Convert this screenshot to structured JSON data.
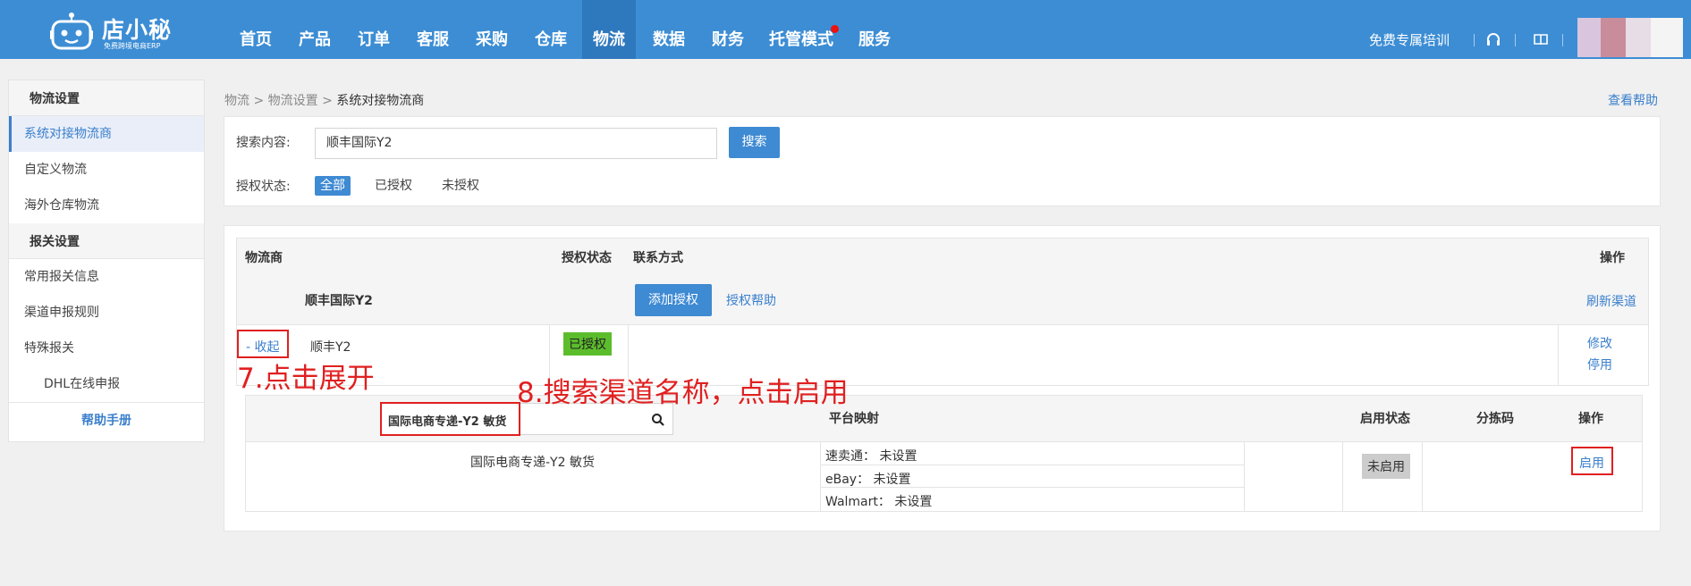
{
  "brand": {
    "title": "店小秘",
    "subtitle": "免费跨境电商ERP"
  },
  "nav": {
    "items": [
      "首页",
      "产品",
      "订单",
      "客服",
      "采购",
      "仓库",
      "物流",
      "数据",
      "财务",
      "托管模式",
      "服务"
    ],
    "active": "物流",
    "training": "免费专属培训",
    "headset_icon": "headset-icon",
    "book_icon": "book-icon"
  },
  "sidebar": {
    "group1": "物流设置",
    "item1": "系统对接物流商",
    "item2": "自定义物流",
    "item3": "海外仓库物流",
    "group2": "报关设置",
    "item4": "常用报关信息",
    "item5": "渠道申报规则",
    "item6": "特殊报关",
    "item7": "DHL在线申报",
    "help": "帮助手册"
  },
  "breadcrumb": {
    "level1": "物流",
    "level2": "物流设置",
    "current": "系统对接物流商",
    "sep": ">"
  },
  "help_link": "查看帮助",
  "search": {
    "label": "搜索内容:",
    "value": "顺丰国际Y2",
    "button": "搜索",
    "auth_label": "授权状态:",
    "filter_all": "全部",
    "filter_authorized": "已授权",
    "filter_unauthorized": "未授权"
  },
  "table": {
    "col_provider": "物流商",
    "col_auth": "授权状态",
    "col_contact": "联系方式",
    "col_action": "操作",
    "provider_name": "顺丰国际Y2",
    "add_auth_button": "添加授权",
    "auth_help": "授权帮助",
    "refresh_channels": "刷新渠道",
    "collapse": "- 收起",
    "account_name": "顺丰Y2",
    "account_status": "已授权",
    "edit": "修改",
    "disable": "停用"
  },
  "channels": {
    "search_value": "国际电商专递-Y2 敏货",
    "col_mapping": "平台映射",
    "col_status": "启用状态",
    "col_sort_code": "分拣码",
    "col_action": "操作",
    "row": {
      "name": "国际电商专递-Y2 敏货",
      "mappings": [
        "速卖通： 未设置",
        "eBay： 未设置",
        "Walmart： 未设置"
      ],
      "status": "未启用",
      "action": "启用"
    }
  },
  "annotations": {
    "step7": "7.点击展开",
    "step8": "8.搜索渠道名称，点击启用"
  },
  "colors": {
    "nav_bg": "#3c8dd4",
    "accent": "#3e8ad3",
    "annotation": "#e02020",
    "authorized": "#5cbd2c"
  }
}
